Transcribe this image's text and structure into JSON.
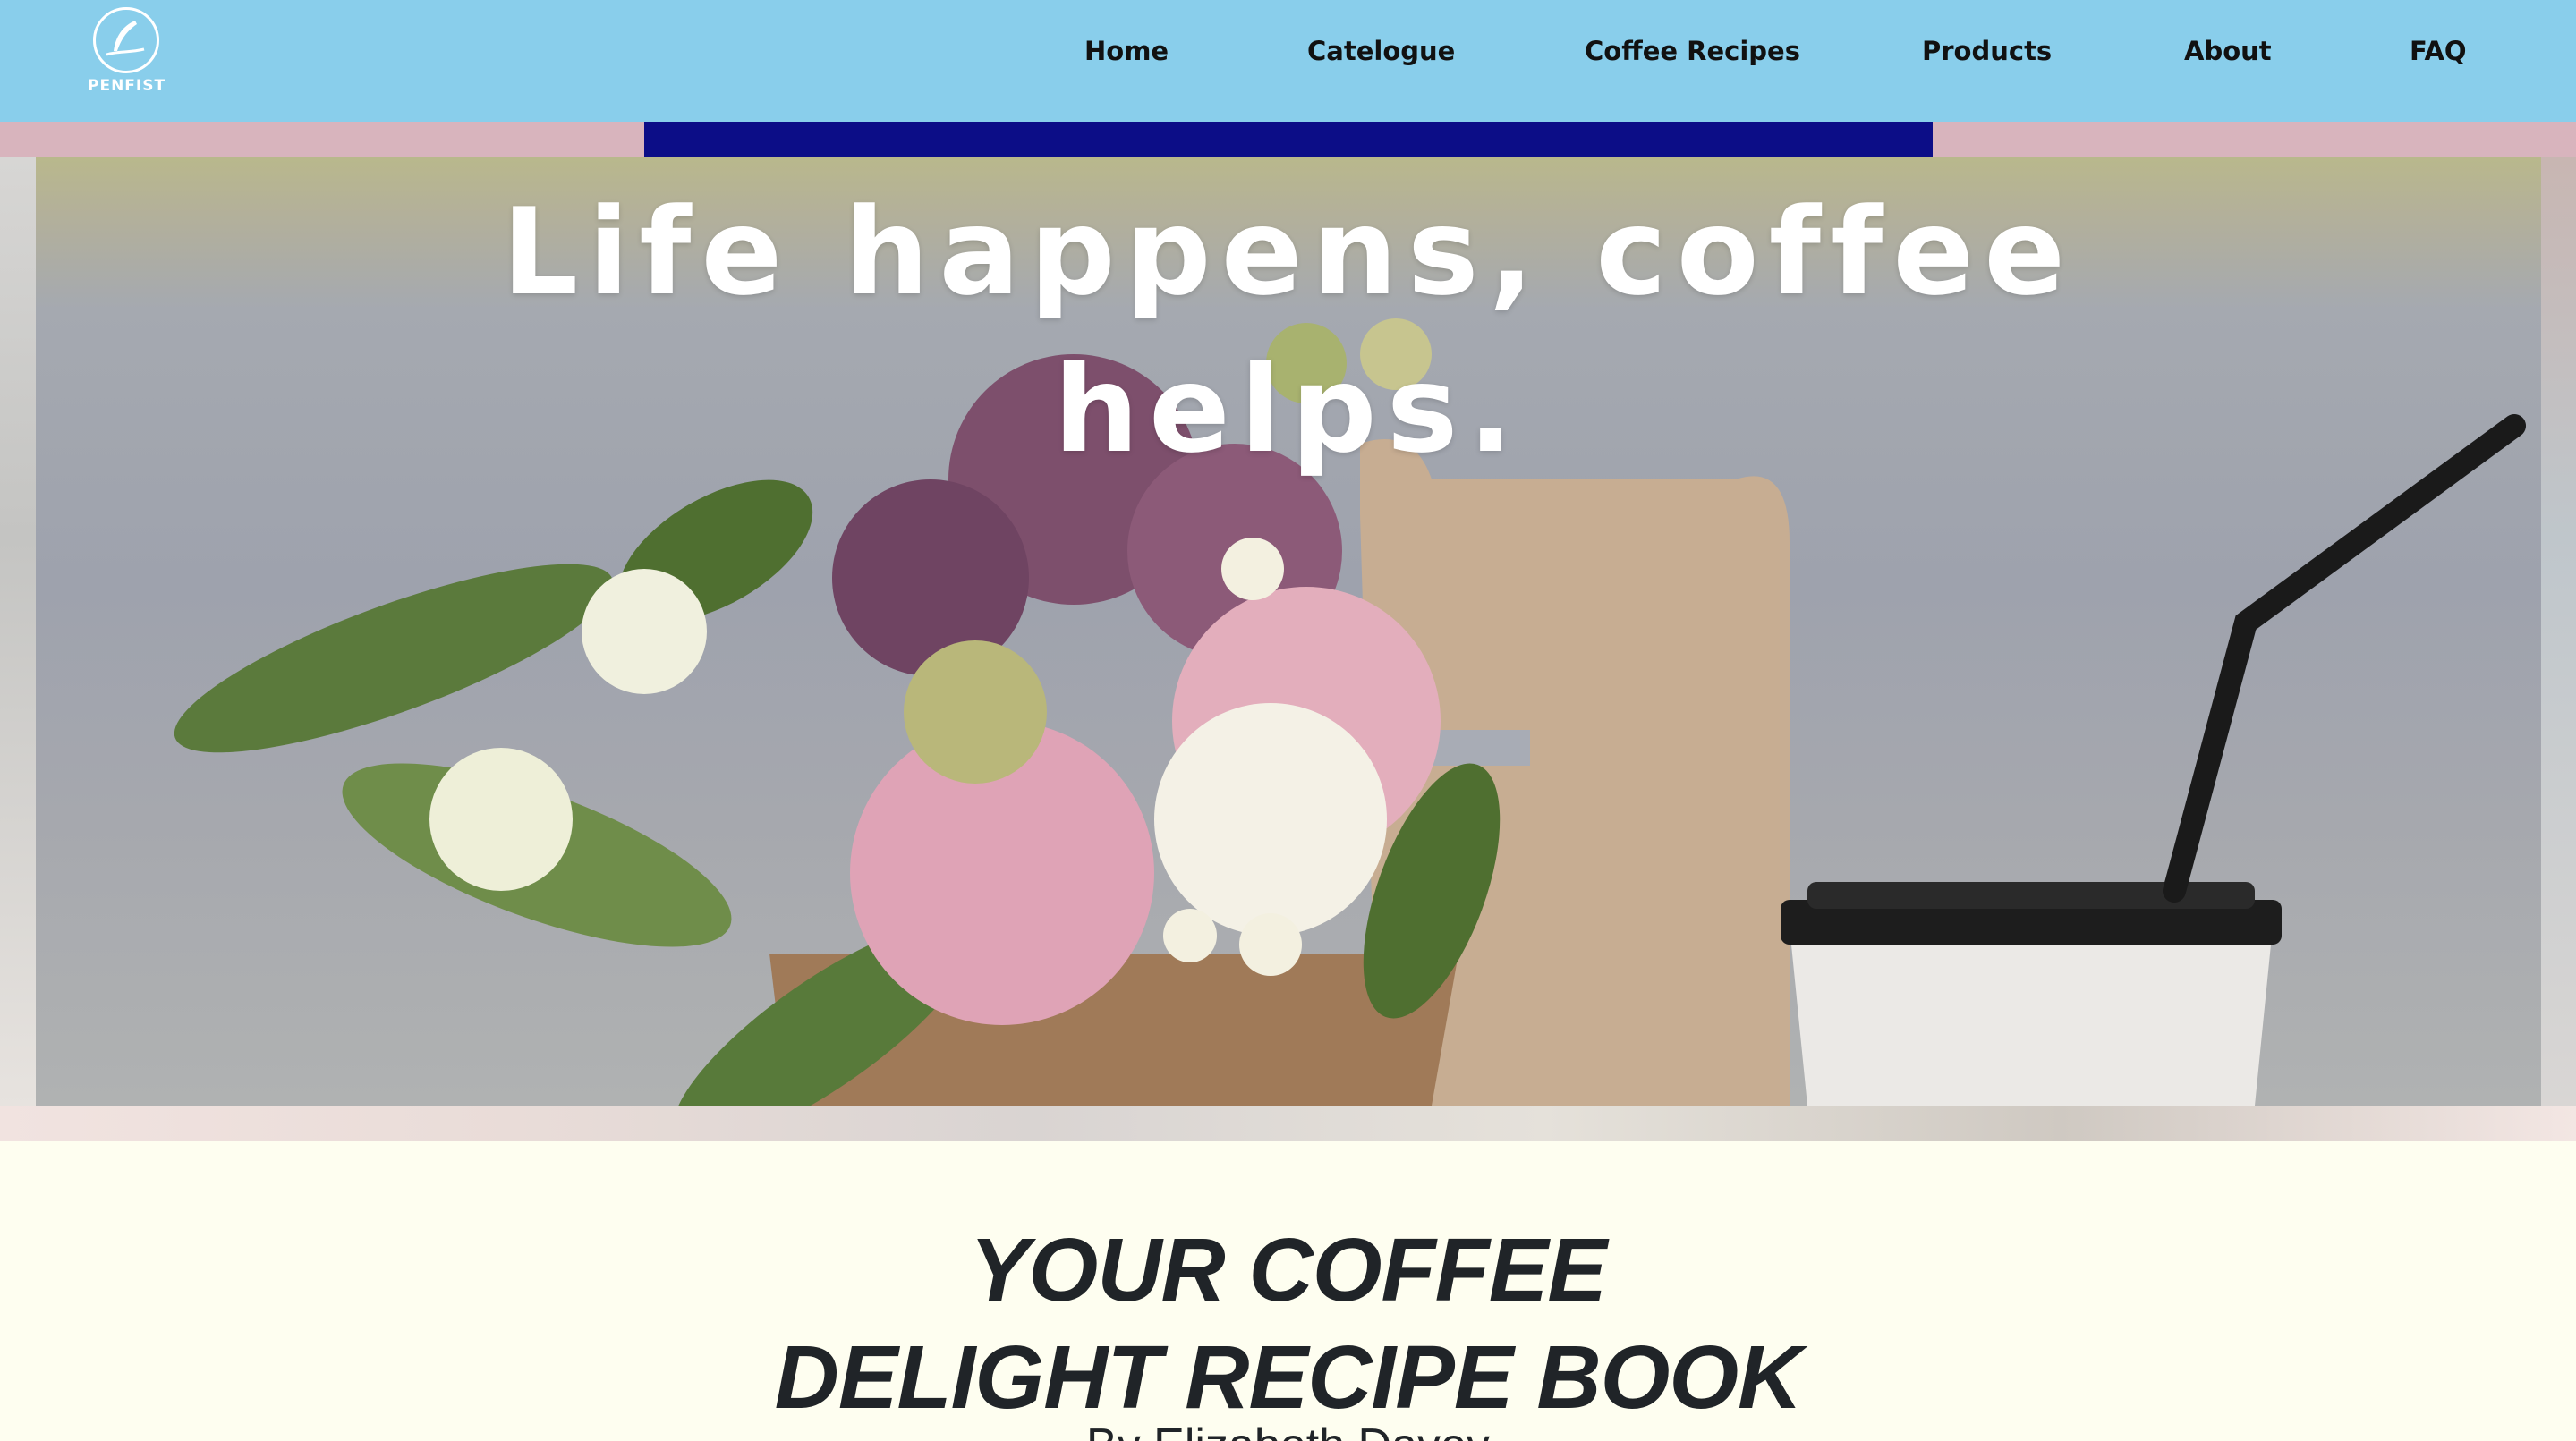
{
  "brand": {
    "logo_text": "PENFIST",
    "logo_icon": "feather-icon"
  },
  "nav": {
    "items": [
      {
        "label": "Home"
      },
      {
        "label": "Catelogue"
      },
      {
        "label": "Coffee Recipes"
      },
      {
        "label": "Products"
      },
      {
        "label": "About"
      },
      {
        "label": "FAQ"
      }
    ]
  },
  "hero": {
    "headline": "Life happens, coffee helps."
  },
  "content": {
    "title": "YOUR COFFEE DELIGHT RECIPE BOOK",
    "author": "By Elizabeth Davey"
  },
  "colors": {
    "nav_bg": "#89ceeb",
    "band_pink": "#d8b4bd",
    "band_navy": "#0c0d87",
    "page_bg": "#fefef0",
    "text_dark": "#202428"
  }
}
